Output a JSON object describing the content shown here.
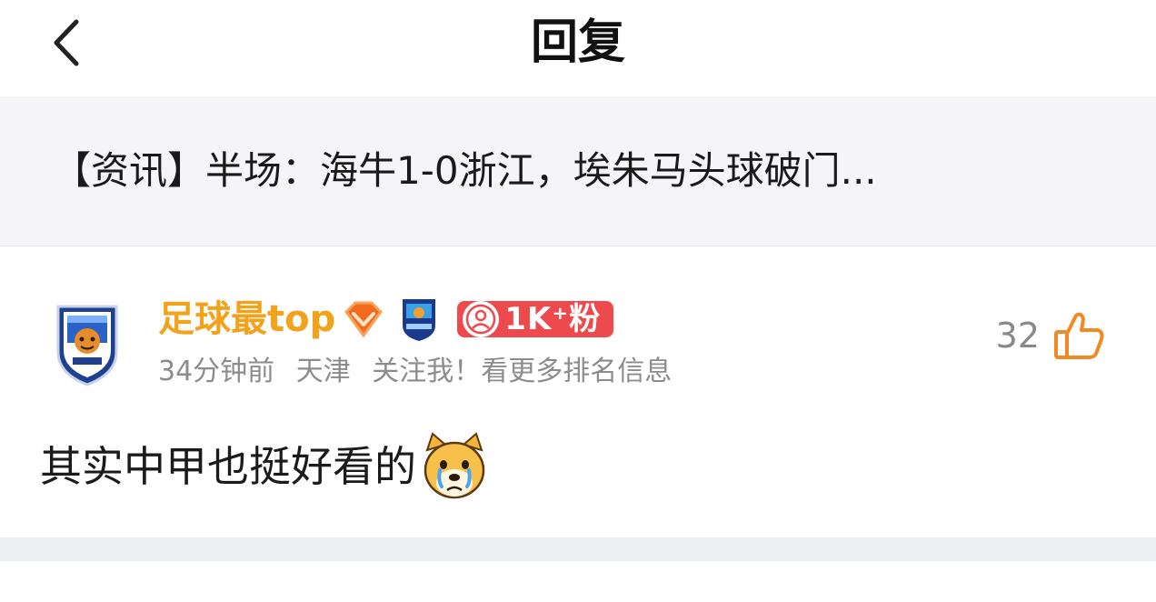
{
  "header": {
    "back_icon": "chevron-left-icon",
    "title": "回复"
  },
  "article": {
    "title": "【资讯】半场：海牛1-0浙江，埃朱马头球破门..."
  },
  "comment": {
    "user": {
      "name": "足球最top",
      "level_badge_icon": "diamond-icon",
      "team_badge_icon": "team-logo-icon",
      "fans_badge": "1K⁺粉"
    },
    "meta": {
      "time": "34分钟前",
      "location": "天津",
      "extra": "关注我！看更多排名信息"
    },
    "likes": "32",
    "text": "其实中甲也挺好看的",
    "emoji": "crying-dog-emoji"
  },
  "colors": {
    "username": "#f3a21b",
    "fans_badge": "#ee4a4d",
    "like_icon": "#f08a24",
    "meta": "#8c8c8c"
  }
}
